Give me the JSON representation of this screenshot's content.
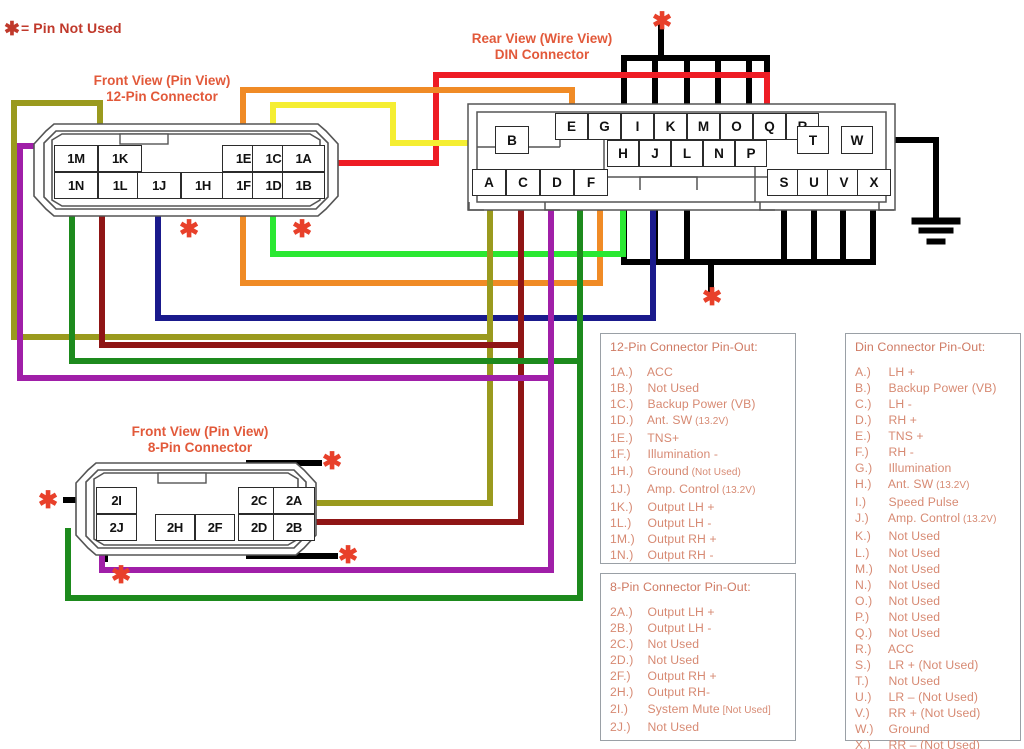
{
  "legend": {
    "asterisk_glyph": "✱",
    "text": "= Pin Not Used"
  },
  "colors": {
    "title_text": "#e2593a",
    "legend_text": "#c0392b",
    "panel_text": "#d78a73",
    "panel_border": "#9aa0a6",
    "wire_black": "#000000",
    "wire_red": "#ee1c24",
    "wire_orange": "#f08b26",
    "wire_yellow": "#f5ee32",
    "wire_olive": "#9a9a1e",
    "wire_maroon": "#8f1515",
    "wire_darkgreen": "#1d8a1d",
    "wire_brightgreen": "#2ae832",
    "wire_purple": "#a01fa8",
    "wire_navy": "#1a1a8c"
  },
  "connectors": {
    "twelve_pin": {
      "title_line1": "Front View (Pin View)",
      "title_line2": "12-Pin Connector",
      "pins": [
        "1M",
        "1K",
        "1N",
        "1L",
        "1J",
        "1H",
        "1E",
        "1C",
        "1A",
        "1F",
        "1D",
        "1B"
      ]
    },
    "din": {
      "title_line1": "Rear View (Wire View)",
      "title_line2": "DIN Connector",
      "pins": [
        "B",
        "E",
        "G",
        "I",
        "K",
        "M",
        "O",
        "Q",
        "R",
        "T",
        "W",
        "H",
        "J",
        "L",
        "N",
        "P",
        "A",
        "C",
        "D",
        "F",
        "S",
        "U",
        "V",
        "X"
      ]
    },
    "eight_pin": {
      "title_line1": "Front View (Pin View)",
      "title_line2": "8-Pin Connector",
      "pins": [
        "2I",
        "2J",
        "2H",
        "2F",
        "2C",
        "2A",
        "2D",
        "2B"
      ]
    }
  },
  "panels": {
    "twelve_pin": {
      "heading": "12-Pin Connector Pin-Out:",
      "rows": [
        {
          "key": "1A.)",
          "value": "ACC",
          "note": ""
        },
        {
          "key": "1B.)",
          "value": "Not Used",
          "note": ""
        },
        {
          "key": "1C.)",
          "value": "Backup Power (VB)",
          "note": ""
        },
        {
          "key": "1D.)",
          "value": "Ant. SW",
          "note": "(13.2V)"
        },
        {
          "key": "1E.)",
          "value": "TNS+",
          "note": ""
        },
        {
          "key": "1F.)",
          "value": "Illumination -",
          "note": ""
        },
        {
          "key": "1H.)",
          "value": "Ground",
          "note": "(Not Used)"
        },
        {
          "key": "1J.)",
          "value": "Amp. Control",
          "note": "(13.2V)"
        },
        {
          "key": "1K.)",
          "value": "Output LH +",
          "note": ""
        },
        {
          "key": "1L.)",
          "value": "Output LH -",
          "note": ""
        },
        {
          "key": "1M.)",
          "value": "Output RH +",
          "note": ""
        },
        {
          "key": "1N.)",
          "value": "Output RH -",
          "note": ""
        }
      ]
    },
    "eight_pin": {
      "heading": "8-Pin Connector Pin-Out:",
      "rows": [
        {
          "key": "2A.)",
          "value": "Output LH +",
          "note": ""
        },
        {
          "key": "2B.)",
          "value": "Output LH -",
          "note": ""
        },
        {
          "key": "2C.)",
          "value": "Not Used",
          "note": ""
        },
        {
          "key": "2D.)",
          "value": "Not Used",
          "note": ""
        },
        {
          "key": "2F.)",
          "value": "Output RH +",
          "note": ""
        },
        {
          "key": "2H.)",
          "value": "Output RH-",
          "note": ""
        },
        {
          "key": "2I.)",
          "value": "System Mute",
          "note": "[Not Used]"
        },
        {
          "key": "2J.)",
          "value": "Not Used",
          "note": ""
        }
      ]
    },
    "din": {
      "heading": "Din Connector Pin-Out:",
      "rows": [
        {
          "key": "A.)",
          "value": "LH +",
          "note": ""
        },
        {
          "key": "B.)",
          "value": "Backup Power (VB)",
          "note": ""
        },
        {
          "key": "C.)",
          "value": "LH -",
          "note": ""
        },
        {
          "key": "D.)",
          "value": "RH +",
          "note": ""
        },
        {
          "key": "E.)",
          "value": "TNS +",
          "note": ""
        },
        {
          "key": "F.)",
          "value": "RH -",
          "note": ""
        },
        {
          "key": "G.)",
          "value": "Illumination",
          "note": ""
        },
        {
          "key": "H.)",
          "value": "Ant. SW",
          "note": "(13.2V)"
        },
        {
          "key": "I.)",
          "value": "Speed Pulse",
          "note": ""
        },
        {
          "key": "J.)",
          "value": "Amp. Control",
          "note": "(13.2V)"
        },
        {
          "key": "K.)",
          "value": "Not Used",
          "note": ""
        },
        {
          "key": "L.)",
          "value": "Not Used",
          "note": ""
        },
        {
          "key": "M.)",
          "value": "Not Used",
          "note": ""
        },
        {
          "key": "N.)",
          "value": "Not Used",
          "note": ""
        },
        {
          "key": "O.)",
          "value": "Not Used",
          "note": ""
        },
        {
          "key": "P.)",
          "value": "Not Used",
          "note": ""
        },
        {
          "key": "Q.)",
          "value": "Not Used",
          "note": ""
        },
        {
          "key": "R.)",
          "value": "ACC",
          "note": ""
        },
        {
          "key": "S.)",
          "value": "LR + (Not Used)",
          "note": ""
        },
        {
          "key": "T.)",
          "value": "Not Used",
          "note": ""
        },
        {
          "key": "U.)",
          "value": "LR – (Not Used)",
          "note": ""
        },
        {
          "key": "V.)",
          "value": "RR + (Not Used)",
          "note": ""
        },
        {
          "key": "W.)",
          "value": "Ground",
          "note": ""
        },
        {
          "key": "X.)",
          "value": "RR – (Not Used)",
          "note": ""
        }
      ]
    }
  }
}
